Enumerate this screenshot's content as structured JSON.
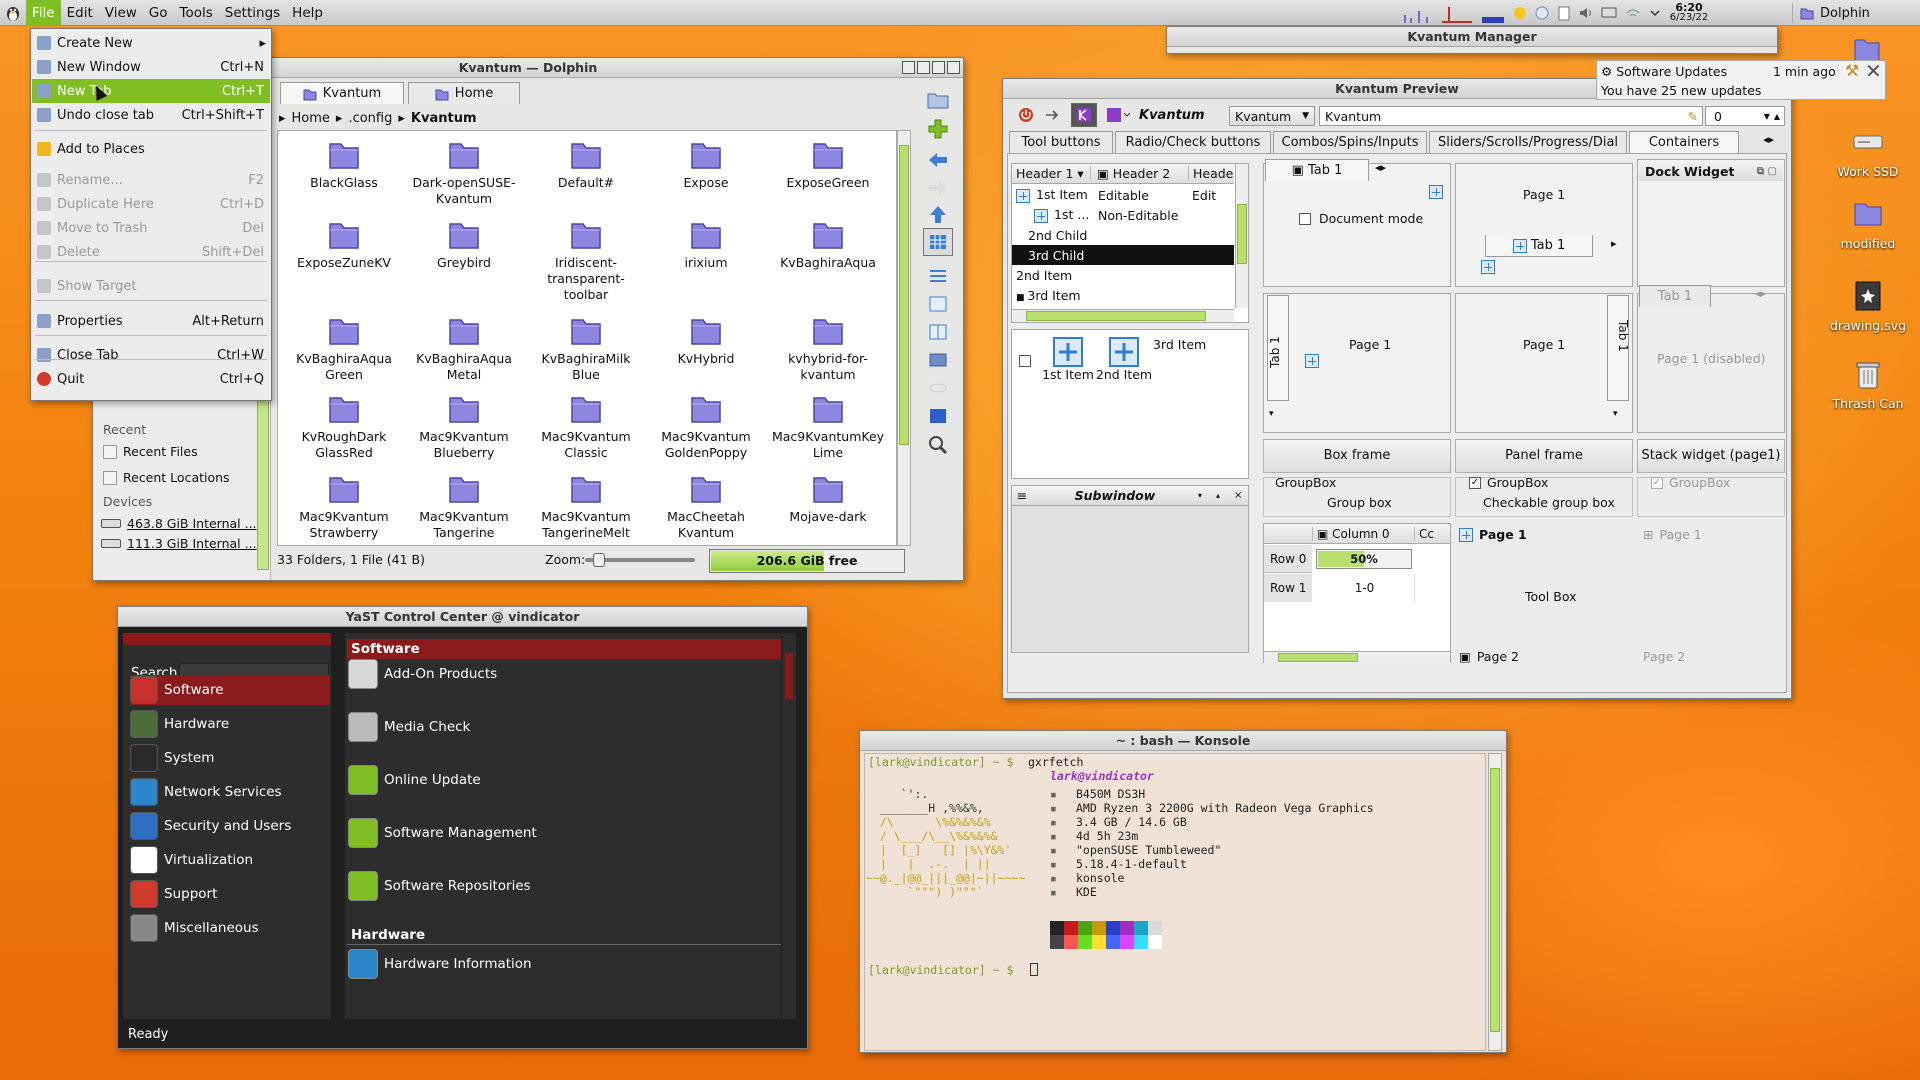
{
  "panel": {
    "menus": [
      "File",
      "Edit",
      "View",
      "Go",
      "Tools",
      "Settings",
      "Help"
    ],
    "clock_time": "6:20",
    "clock_date": "6/23/22",
    "task_label": "Dolphin"
  },
  "file_menu": {
    "items": [
      {
        "label": "Create New",
        "shortcut": "",
        "state": "normal",
        "submenu": true,
        "icon": "create-new-icon"
      },
      {
        "label": "New Window",
        "shortcut": "Ctrl+N",
        "state": "normal",
        "icon": "new-window-icon"
      },
      {
        "label": "New Tab",
        "shortcut": "Ctrl+T",
        "state": "highlighted",
        "icon": "new-tab-icon"
      },
      {
        "label": "Undo close tab",
        "shortcut": "Ctrl+Shift+T",
        "state": "normal",
        "icon": "undo-icon"
      },
      {
        "label": "Add to Places",
        "shortcut": "",
        "state": "normal",
        "icon": "star-icon"
      },
      {
        "label": "Rename...",
        "shortcut": "F2",
        "state": "disabled",
        "icon": "rename-icon"
      },
      {
        "label": "Duplicate Here",
        "shortcut": "Ctrl+D",
        "state": "disabled",
        "icon": "duplicate-icon"
      },
      {
        "label": "Move to Trash",
        "shortcut": "Del",
        "state": "disabled",
        "icon": "trash-icon"
      },
      {
        "label": "Delete",
        "shortcut": "Shift+Del",
        "state": "disabled",
        "icon": "delete-icon"
      },
      {
        "label": "Show Target",
        "shortcut": "",
        "state": "disabled",
        "icon": "show-target-icon"
      },
      {
        "label": "Properties",
        "shortcut": "Alt+Return",
        "state": "normal",
        "icon": "properties-icon"
      },
      {
        "label": "Close Tab",
        "shortcut": "Ctrl+W",
        "state": "normal",
        "icon": "close-tab-icon"
      },
      {
        "label": "Quit",
        "shortcut": "Ctrl+Q",
        "state": "normal",
        "icon": "quit-icon"
      }
    ]
  },
  "dolphin": {
    "title": "Kvantum — Dolphin",
    "tabs": [
      "Kvantum",
      "Home"
    ],
    "breadcrumb": [
      "Home",
      ".config",
      "Kvantum"
    ],
    "folders": [
      "BlackGlass",
      "Dark-openSUSE-Kvantum",
      "Default#",
      "Expose",
      "ExposeGreen",
      "ExposeZuneKV",
      "Greybird",
      "Iridiscent-transparent-toolbar",
      "irixium",
      "KvBaghiraAqua",
      "KvBaghiraAqua Green",
      "KvBaghiraAqua Metal",
      "KvBaghiraMilk Blue",
      "KvHybrid",
      "kvhybrid-for-kvantum",
      "KvRoughDark GlassRed",
      "Mac9Kvantum Blueberry",
      "Mac9Kvantum Classic",
      "Mac9Kvantum GoldenPoppy",
      "Mac9KvantumKey Lime",
      "Mac9Kvantum Strawberry",
      "Mac9Kvantum Tangerine",
      "Mac9Kvantum TangerineMelt",
      "MacCheetah Kvantum",
      "Mojave-dark"
    ],
    "status": "33 Folders, 1 File (41 B)",
    "zoom_label": "Zoom:",
    "free_space": "206.6 GiB free",
    "places": {
      "section_recent": "Recent",
      "recent_files": "Recent Files",
      "recent_locations": "Recent Locations",
      "section_devices": "Devices",
      "dev1": "463.8 GiB Internal ...",
      "dev2": "111.3 GiB Internal ..."
    }
  },
  "yast": {
    "title": "YaST Control Center @ vindicator",
    "search_label": "Search",
    "status": "Ready",
    "categories": [
      {
        "label": "Software",
        "color": "#c8302b",
        "selected": true
      },
      {
        "label": "Hardware",
        "color": "#4d6b39"
      },
      {
        "label": "System",
        "color": "#2b2b2b"
      },
      {
        "label": "Network Services",
        "color": "#2a86c9"
      },
      {
        "label": "Security and Users",
        "color": "#2e6fc2"
      },
      {
        "label": "Virtualization",
        "color": "#ffffff"
      },
      {
        "label": "Support",
        "color": "#d13b2e"
      },
      {
        "label": "Miscellaneous",
        "color": "#888888"
      }
    ],
    "sections": [
      {
        "title": "Software",
        "modules": [
          "Add-On Products",
          "Media Check",
          "Online Update",
          "Software Management",
          "Software Repositories"
        ]
      },
      {
        "title": "Hardware",
        "modules": [
          "Hardware Information"
        ]
      }
    ]
  },
  "konsole": {
    "title": "~ : bash — Konsole",
    "prompt": "[lark@vindicator] ~ $",
    "command": "gxrfetch",
    "user_host": "lark@vindicator",
    "ascii": [
      "     `':.  ",
      "  _______H ,%%&%, ",
      "  /\\      \\%&%&%&%",
      "  / \\___/\\__\\%&%&%&",
      "  |  [_]   [] |%\\Y&%'",
      "  |   |  .-.  | ||  ",
      "~~@._|@@_|||_@@|~||~~~~",
      "      `\"\"\") )\"\"\"`  "
    ],
    "info": [
      "B450M DS3H",
      "AMD Ryzen 3 2200G with Radeon Vega Graphics",
      "3.4 GB / 14.6 GB",
      "4d 5h 23m",
      "\"openSUSE Tumbleweed\"",
      "5.18.4-1-default",
      "konsole",
      "KDE"
    ],
    "palette": [
      "#222222",
      "#c41a1a",
      "#4ea312",
      "#c49b0f",
      "#2740c4",
      "#a12ac4",
      "#1ba6c4",
      "#d9d9d9",
      "#444444",
      "#ff5555",
      "#66dd22",
      "#ffdd33",
      "#4466ff",
      "#dd44ff",
      "#33ddff",
      "#ffffff"
    ]
  },
  "kvm": {
    "title": "Kvantum Manager"
  },
  "notif": {
    "title": "Software Updates",
    "time": "1 min ago",
    "body": "You have 25 new updates"
  },
  "kvp": {
    "title": "Kvantum Preview",
    "combo": "Kvantum",
    "edit": "Kvantum",
    "spin": "0",
    "tabs": [
      "Tool buttons",
      "Radio/Check buttons",
      "Combos/Spins/Inputs",
      "Sliders/Scrolls/Progress/Dial",
      "Containers"
    ],
    "tree_headers": [
      "Header 1",
      "Header 2",
      "Header"
    ],
    "tree_rows": [
      [
        "1st Item",
        "Editable",
        "Edit"
      ],
      [
        "1st ...",
        "Non-Editable",
        ""
      ],
      [
        "2nd Child",
        "",
        ""
      ],
      [
        "3rd Child",
        "",
        ""
      ],
      [
        "2nd Item",
        "",
        ""
      ],
      [
        "3rd Item",
        "",
        ""
      ]
    ],
    "icon_items": [
      "1st Item",
      "2nd Item",
      "3rd Item"
    ],
    "tab1": "Tab 1",
    "page1": "Page 1",
    "doc_mode": "Document mode",
    "page1_disabled": "Page 1 (disabled)",
    "dock_widget": "Dock Widget",
    "box_frame": "Box frame",
    "panel_frame": "Panel frame",
    "stack_widget": "Stack widget (page1)",
    "groupbox": "GroupBox",
    "group_box": "Group box",
    "checkable_group_box": "Checkable group box",
    "subwindow": "Subwindow",
    "column0": "Column 0",
    "col_c": "Cc",
    "row0": "Row 0",
    "row1": "Row 1",
    "progress": "50%",
    "progress_value": 0.5,
    "cell": "1-0",
    "page2": "Page 2",
    "tool_box": "Tool Box"
  },
  "desktop": [
    {
      "label": "Work SSD",
      "icon": "drive-icon"
    },
    {
      "label": "modified",
      "icon": "folder-icon"
    },
    {
      "label": "drawing.svg",
      "icon": "svg-file-icon"
    },
    {
      "label": "Thrash Can",
      "icon": "trash-can-icon"
    }
  ]
}
